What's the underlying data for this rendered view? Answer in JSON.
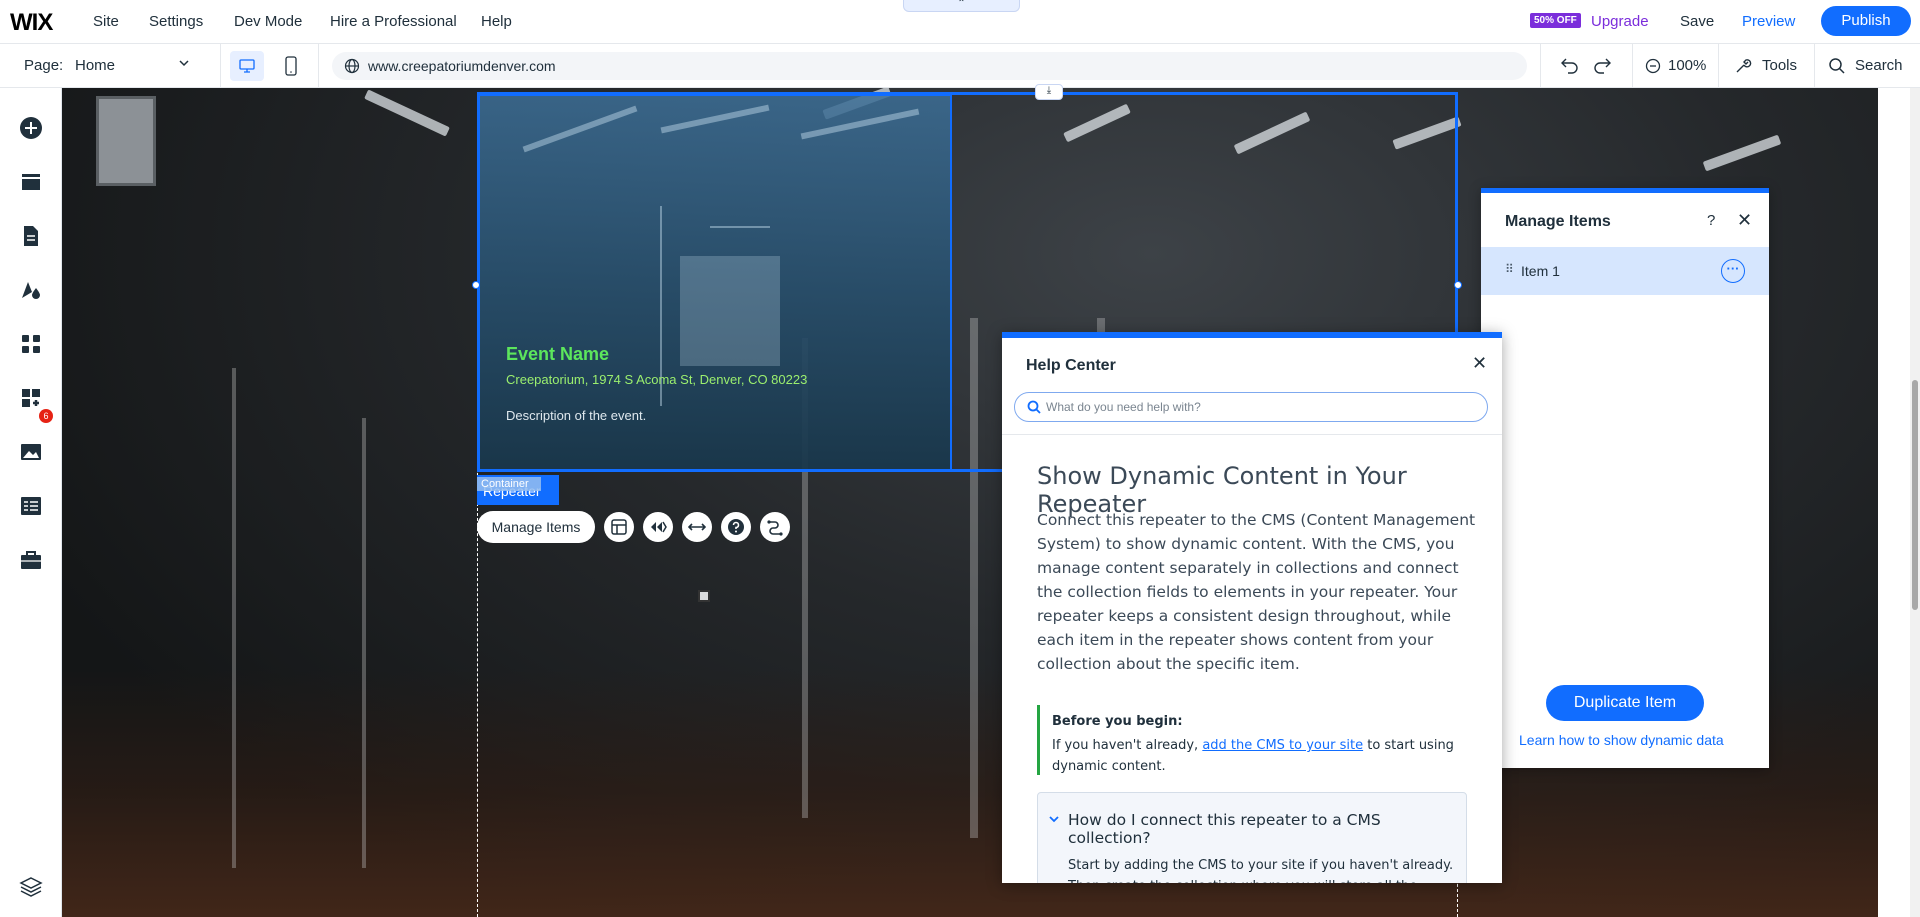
{
  "topbar": {
    "logo": "WIX",
    "menu": [
      "Site",
      "Settings",
      "Dev Mode",
      "Hire a Professional",
      "Help"
    ],
    "notch": "⌃",
    "badge_off": "50% OFF",
    "upgrade": "Upgrade",
    "save": "Save",
    "preview": "Preview",
    "publish": "Publish"
  },
  "secondbar": {
    "page_label": "Page:",
    "page_value": "Home",
    "url": "www.creepatoriumdenver.com",
    "zoom": "100%",
    "tools": "Tools",
    "search": "Search"
  },
  "leftbar": {
    "icons": [
      "add-icon",
      "sections-icon",
      "pages-icon",
      "design-icon",
      "apps-icon",
      "business-icon",
      "media-icon",
      "cms-icon",
      "portfolio-icon",
      "layers-icon"
    ],
    "apps_badge": "6"
  },
  "canvas": {
    "event_name": "Event Name",
    "event_address": "Creepatorium, 1974 S Acoma St, Denver, CO 80223",
    "event_description": "Description of the event.",
    "repeater_tag": "Repeater",
    "container_tag": "Container",
    "manage_items_button": "Manage Items",
    "toolbar_icons": [
      "layout-icon",
      "animation-icon",
      "stretch-icon",
      "help-icon",
      "connect-icon"
    ]
  },
  "manage_items_panel": {
    "title": "Manage Items",
    "help": "?",
    "close": "✕",
    "items": [
      {
        "label": "Item 1"
      }
    ],
    "more": "···",
    "duplicate_button": "Duplicate Item",
    "learn_link": "Learn how to show dynamic data"
  },
  "help_center": {
    "title": "Help Center",
    "close": "✕",
    "search_placeholder": "What do you need help with?",
    "heading": "Show Dynamic Content in Your Repeater",
    "body": "Connect this repeater to the CMS (Content Management System) to show dynamic content. With the CMS, you manage content separately in collections and connect the collection fields to elements in your repeater. Your repeater keeps a consistent design throughout, while each item in the repeater shows content from your collection about the specific item.",
    "callout_title": "Before you begin:",
    "callout_prefix": "If you haven't already, ",
    "callout_link": "add the CMS to your site",
    "callout_suffix": " to start using dynamic content.",
    "accordion_title": "How do I connect this repeater to a CMS collection?",
    "accordion_body": "Start by adding the CMS to your site if you haven't already. Then create the collection where you will store all the"
  },
  "colors": {
    "accent": "#116dff",
    "upgrade": "#7b2ddb",
    "event_name": "#5ce65c",
    "callout_border": "#25a542"
  }
}
